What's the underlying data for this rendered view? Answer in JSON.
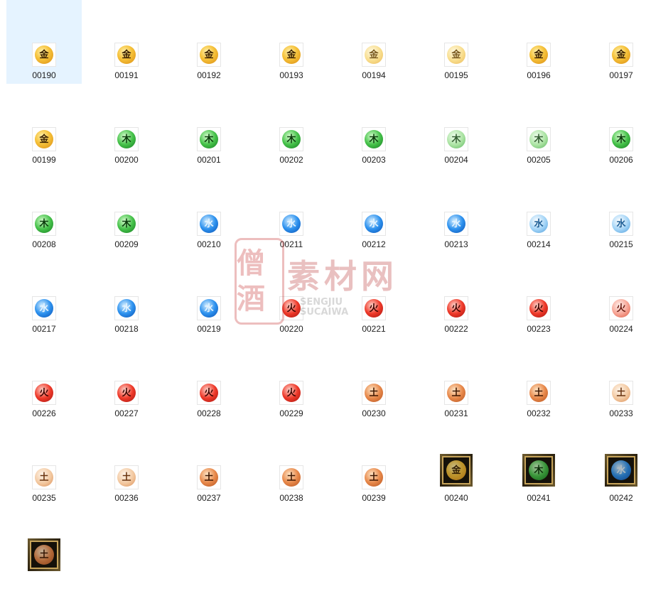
{
  "files": [
    {
      "name": "00190",
      "glyph": "金",
      "tone": "gold",
      "selected": true
    },
    {
      "name": "00191",
      "glyph": "金",
      "tone": "gold"
    },
    {
      "name": "00192",
      "glyph": "金",
      "tone": "gold"
    },
    {
      "name": "00193",
      "glyph": "金",
      "tone": "gold"
    },
    {
      "name": "00194",
      "glyph": "金",
      "tone": "gold-pale"
    },
    {
      "name": "00195",
      "glyph": "金",
      "tone": "gold-pale"
    },
    {
      "name": "00196",
      "glyph": "金",
      "tone": "gold"
    },
    {
      "name": "00197",
      "glyph": "金",
      "tone": "gold"
    },
    {
      "name": "00199",
      "glyph": "金",
      "tone": "gold"
    },
    {
      "name": "00200",
      "glyph": "木",
      "tone": "green"
    },
    {
      "name": "00201",
      "glyph": "木",
      "tone": "green"
    },
    {
      "name": "00202",
      "glyph": "木",
      "tone": "green"
    },
    {
      "name": "00203",
      "glyph": "木",
      "tone": "green"
    },
    {
      "name": "00204",
      "glyph": "木",
      "tone": "green-pale"
    },
    {
      "name": "00205",
      "glyph": "木",
      "tone": "green-pale"
    },
    {
      "name": "00206",
      "glyph": "木",
      "tone": "green"
    },
    {
      "name": "00208",
      "glyph": "木",
      "tone": "green"
    },
    {
      "name": "00209",
      "glyph": "木",
      "tone": "green"
    },
    {
      "name": "00210",
      "glyph": "水",
      "tone": "blue"
    },
    {
      "name": "00211",
      "glyph": "水",
      "tone": "blue"
    },
    {
      "name": "00212",
      "glyph": "水",
      "tone": "blue"
    },
    {
      "name": "00213",
      "glyph": "水",
      "tone": "blue"
    },
    {
      "name": "00214",
      "glyph": "水",
      "tone": "blue-pale"
    },
    {
      "name": "00215",
      "glyph": "水",
      "tone": "blue-pale"
    },
    {
      "name": "00217",
      "glyph": "水",
      "tone": "blue"
    },
    {
      "name": "00218",
      "glyph": "水",
      "tone": "blue"
    },
    {
      "name": "00219",
      "glyph": "水",
      "tone": "blue"
    },
    {
      "name": "00220",
      "glyph": "火",
      "tone": "red"
    },
    {
      "name": "00221",
      "glyph": "火",
      "tone": "red"
    },
    {
      "name": "00222",
      "glyph": "火",
      "tone": "red"
    },
    {
      "name": "00223",
      "glyph": "火",
      "tone": "red"
    },
    {
      "name": "00224",
      "glyph": "火",
      "tone": "red-pale"
    },
    {
      "name": "00226",
      "glyph": "火",
      "tone": "red"
    },
    {
      "name": "00227",
      "glyph": "火",
      "tone": "red"
    },
    {
      "name": "00228",
      "glyph": "火",
      "tone": "red"
    },
    {
      "name": "00229",
      "glyph": "火",
      "tone": "red"
    },
    {
      "name": "00230",
      "glyph": "土",
      "tone": "earth"
    },
    {
      "name": "00231",
      "glyph": "土",
      "tone": "earth"
    },
    {
      "name": "00232",
      "glyph": "土",
      "tone": "earth"
    },
    {
      "name": "00233",
      "glyph": "土",
      "tone": "earth-pale"
    },
    {
      "name": "00235",
      "glyph": "土",
      "tone": "earth-pale"
    },
    {
      "name": "00236",
      "glyph": "土",
      "tone": "earth-pale"
    },
    {
      "name": "00237",
      "glyph": "土",
      "tone": "earth"
    },
    {
      "name": "00238",
      "glyph": "土",
      "tone": "earth"
    },
    {
      "name": "00239",
      "glyph": "土",
      "tone": "earth"
    },
    {
      "name": "00240",
      "glyph": "金",
      "tone": "gold",
      "framed": true
    },
    {
      "name": "00241",
      "glyph": "木",
      "tone": "green",
      "framed": true
    },
    {
      "name": "00242",
      "glyph": "水",
      "tone": "blue",
      "framed": true
    },
    {
      "name": "",
      "glyph": "土",
      "tone": "earth",
      "framed": true
    }
  ],
  "watermark": {
    "seal": "僧酒",
    "title": "素材网",
    "sub_line1": "SENGJIU",
    "sub_line2": "SUCAIWA"
  }
}
